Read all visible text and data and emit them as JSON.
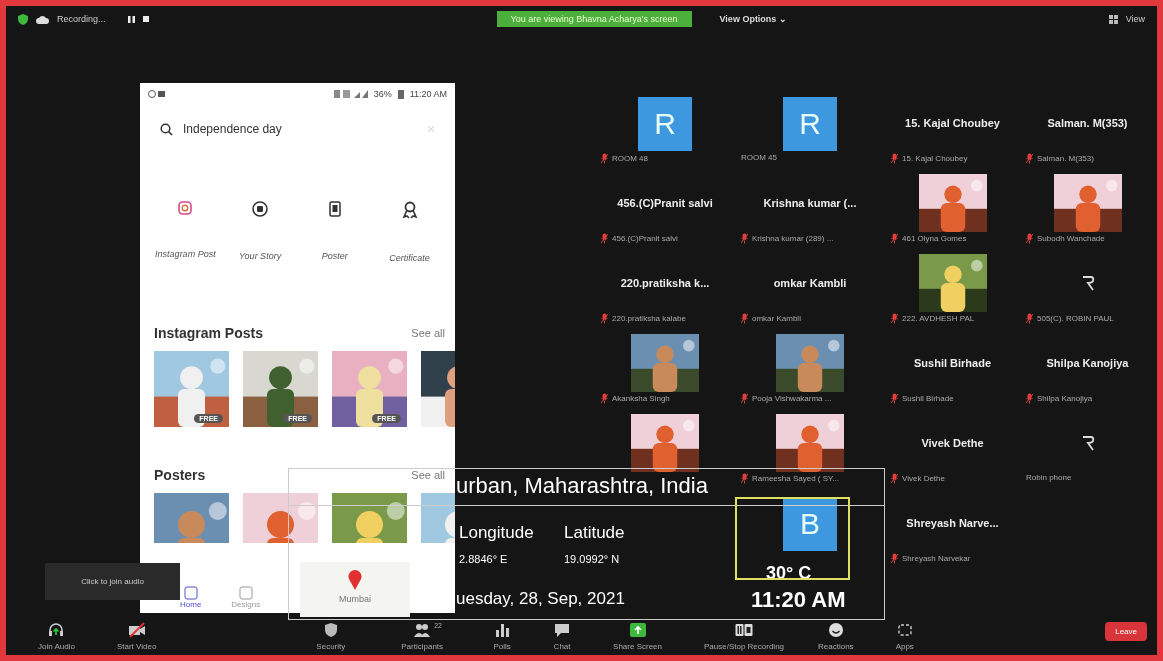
{
  "top_bar": {
    "recording": "Recording...",
    "banner": "You are viewing Bhavna Acharya's screen",
    "view_options": "View Options ⌄",
    "view": "View"
  },
  "shared_phone": {
    "status_battery": "36%",
    "status_time": "11:20 AM",
    "search": {
      "value": "Independence day"
    },
    "categories": [
      {
        "kind": "instagram",
        "label": "Instagram Post"
      },
      {
        "kind": "story",
        "label": "Your Story"
      },
      {
        "kind": "poster",
        "label": "Poster"
      },
      {
        "kind": "certificate",
        "label": "Certificate"
      }
    ],
    "sections": [
      {
        "title": "Instagram Posts",
        "link": "See all",
        "thumbs": [
          {
            "kind": "picture",
            "badge": "FREE"
          },
          {
            "kind": "picture",
            "badge": "FREE"
          },
          {
            "kind": "picture",
            "badge": "FREE"
          },
          {
            "kind": "picture"
          }
        ]
      },
      {
        "title": "Posters",
        "link": "See all",
        "thumbs": [
          {
            "kind": "picture"
          },
          {
            "kind": "picture"
          },
          {
            "kind": "picture"
          },
          {
            "kind": "picture"
          }
        ]
      }
    ],
    "nav": [
      {
        "label": "Home",
        "selected": true
      },
      {
        "label": "Designs",
        "selected": false
      }
    ]
  },
  "gallery": {
    "rows": [
      [
        {
          "kind": "avatar",
          "letter": "R",
          "label": "ROOM 48",
          "muted": true
        },
        {
          "kind": "avatar",
          "letter": "R",
          "label": "ROOM 45",
          "muted": false
        },
        {
          "kind": "name",
          "title": "15. Kajal Choubey",
          "label": "15. Kajal Choubey",
          "muted": true
        },
        {
          "kind": "name",
          "title": "Salman. M(353)",
          "label": "Salman. M(353)",
          "muted": true
        }
      ],
      [
        {
          "kind": "name",
          "title": "456.(C)Pranit salvi",
          "label": "456.(C)Pranit salvi",
          "muted": true
        },
        {
          "kind": "name",
          "title": "Krishna kumar (...",
          "label": "Krishna kumar (289) ...",
          "muted": true
        },
        {
          "kind": "video",
          "label": "461 Olyna Gomes",
          "muted": true
        },
        {
          "kind": "video",
          "label": "Subodh Wanchade",
          "muted": true
        }
      ],
      [
        {
          "kind": "name",
          "title": "220.pratiksha k...",
          "label": "220.pratiksha kalabe",
          "muted": true
        },
        {
          "kind": "name",
          "title": "omkar Kambli",
          "label": "omkar Kambli",
          "muted": true
        },
        {
          "kind": "video",
          "label": "222. AVDHESH PAL",
          "muted": true
        },
        {
          "kind": "logo",
          "label": "505(C). ROBIN PAUL",
          "muted": true
        }
      ],
      [
        {
          "kind": "video",
          "label": "Akanksha Singh",
          "muted": true
        },
        {
          "kind": "video",
          "label": "Pooja Vishwakarma ...",
          "muted": true
        },
        {
          "kind": "name",
          "title": "Sushil Birhade",
          "label": "Sushil Birhade",
          "muted": true
        },
        {
          "kind": "name",
          "title": "Shilpa Kanojiya",
          "label": "Shilpa Kanojiya",
          "muted": true
        }
      ],
      [
        {
          "kind": "video",
          "muted": false
        },
        {
          "kind": "video",
          "label": "Rameesha Sayed ( SY...",
          "muted": true
        },
        {
          "kind": "name",
          "title": "Vivek Dethe",
          "label": "Vivek Dethe",
          "muted": true
        },
        {
          "kind": "logo",
          "label": "Robin phone",
          "muted": false
        }
      ],
      [
        {
          "kind": "empty"
        },
        {
          "kind": "avatar",
          "letter": "B",
          "muted": false
        },
        {
          "kind": "name",
          "title": "Shreyash Narve...",
          "label": "Shreyash Narvekar",
          "muted": true
        },
        {
          "kind": "empty"
        }
      ]
    ]
  },
  "weather_widget": {
    "location": "urban, Maharashtra, India",
    "longitude_label": "Longitude",
    "latitude_label": "Latitude",
    "longitude": "2.8846° E",
    "latitude": "19.0992° N",
    "date": "uesday, 28, Sep, 2021",
    "temperature": "30° C",
    "time": "11:20 AM"
  },
  "map_thumbnail": {
    "city": "Mumbai"
  },
  "tooltip": "Click to join audio",
  "toolbar": {
    "items": [
      {
        "kind": "audio",
        "label": "Join Audio"
      },
      {
        "kind": "video",
        "label": "Start Video"
      },
      {
        "kind": "security",
        "label": "Security"
      },
      {
        "kind": "participants",
        "label": "Participants",
        "count": "22"
      },
      {
        "kind": "polls",
        "label": "Polls"
      },
      {
        "kind": "chat",
        "label": "Chat"
      },
      {
        "kind": "share",
        "label": "Share Screen"
      },
      {
        "kind": "record",
        "label": "Pause/Stop Recording"
      },
      {
        "kind": "reactions",
        "label": "Reactions"
      },
      {
        "kind": "apps",
        "label": "Apps"
      }
    ],
    "leave": "Leave"
  }
}
